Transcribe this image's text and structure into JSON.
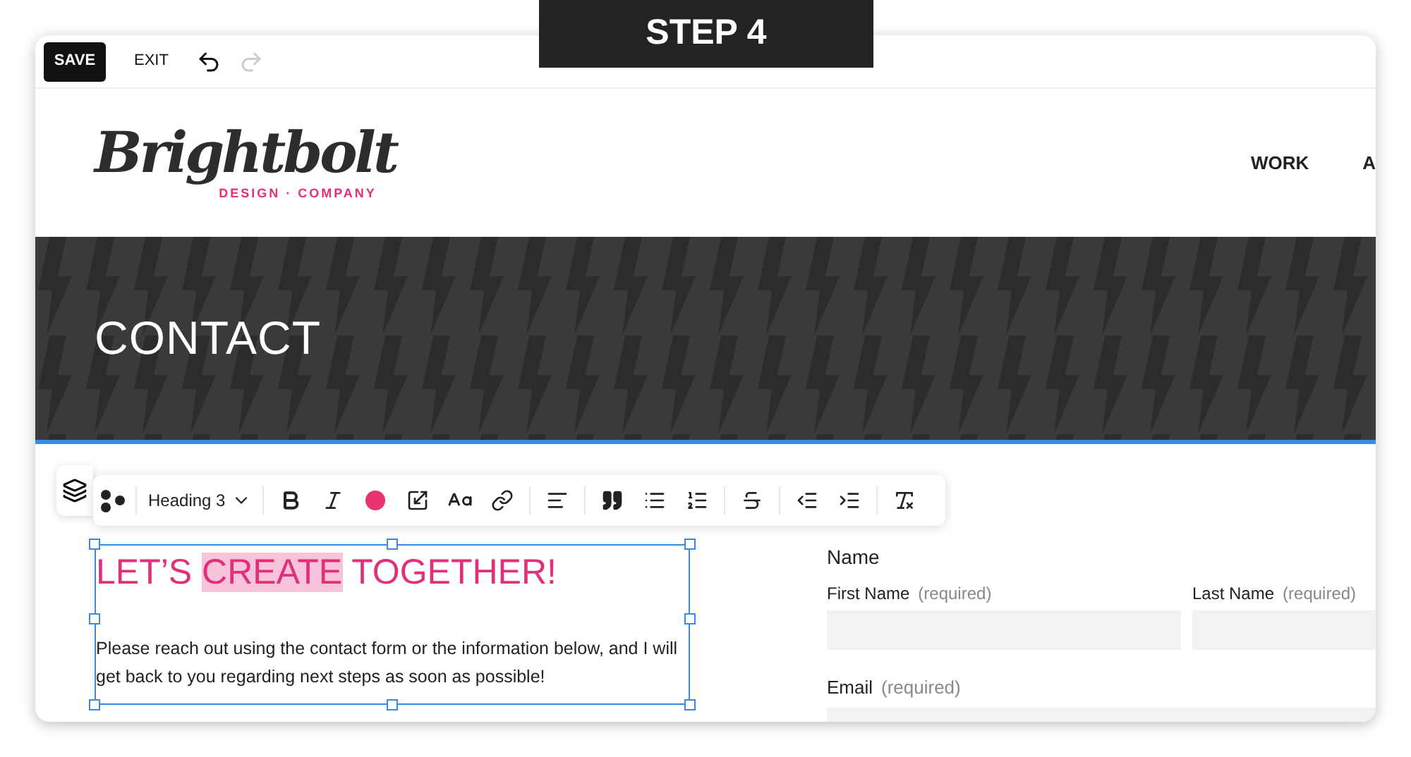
{
  "step_banner": "STEP 4",
  "topbar": {
    "save": "SAVE",
    "exit": "EXIT",
    "undo_disabled": false,
    "redo_disabled": true
  },
  "header": {
    "logo": "Brightbolt",
    "logo_tagline": "DESIGN · COMPANY",
    "nav": [
      "WORK",
      "A"
    ]
  },
  "banner": {
    "title": "CONTACT"
  },
  "toolbar": {
    "style_label": "Heading 3",
    "color": "#e8336f"
  },
  "text_block": {
    "heading": [
      {
        "text": "LET’S ",
        "highlighted": false
      },
      {
        "text": "CREATE",
        "highlighted": true
      },
      {
        "text": " TOGETHER!",
        "highlighted": false
      }
    ],
    "paragraph": "Please reach out using the contact form or the information below, and I will get back to you regarding next steps as soon as possible!"
  },
  "form": {
    "group_label": "Name",
    "fields": [
      {
        "label": "First Name",
        "hint": "(required)"
      },
      {
        "label": "Last Name",
        "hint": "(required)"
      }
    ],
    "email": {
      "label": "Email",
      "hint": "(required)"
    }
  }
}
